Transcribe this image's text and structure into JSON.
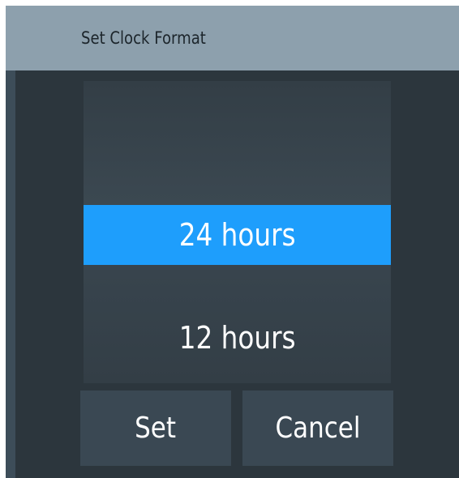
{
  "dialog": {
    "title": "Set Clock Format"
  },
  "picker": {
    "options": [
      {
        "label": "",
        "selected": false
      },
      {
        "label": "24 hours",
        "selected": true
      },
      {
        "label": "12 hours",
        "selected": false
      }
    ],
    "selected_color": "#1e9efc"
  },
  "buttons": {
    "set_label": "Set",
    "cancel_label": "Cancel"
  }
}
